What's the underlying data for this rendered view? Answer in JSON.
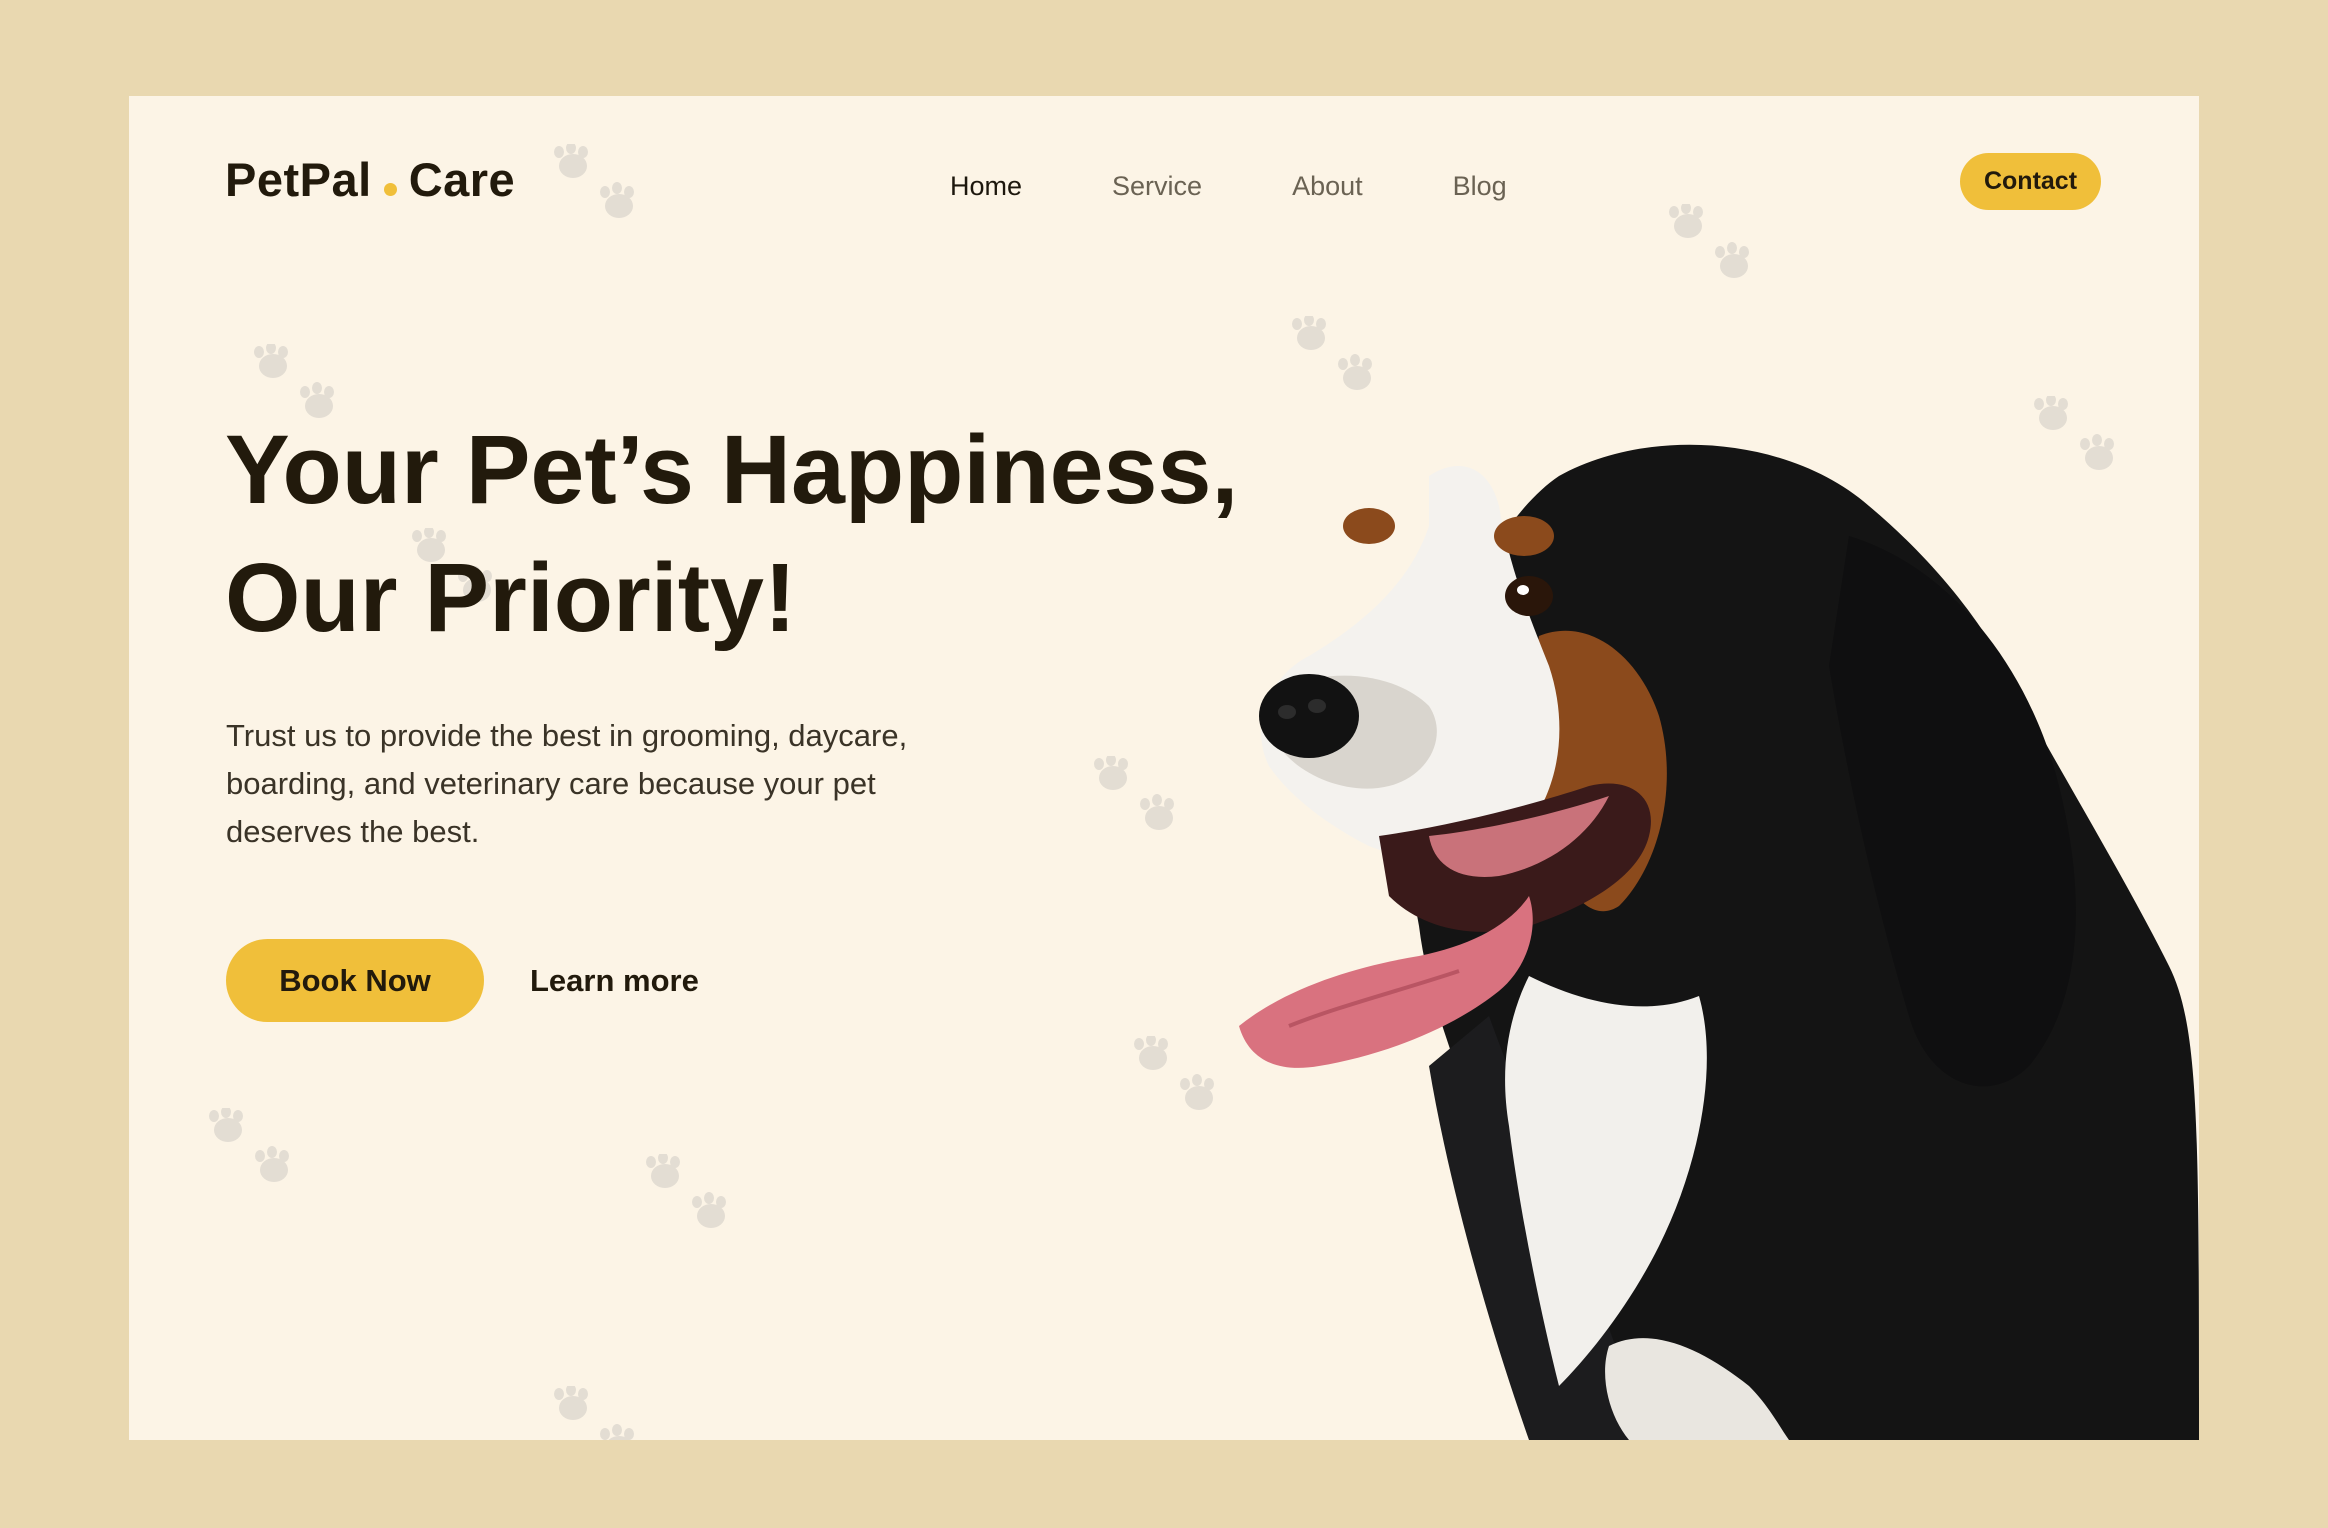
{
  "brand": {
    "name_left": "PetPal",
    "name_right": "Care",
    "accent": "#f0bf3a"
  },
  "nav": {
    "items": [
      {
        "label": "Home",
        "active": true
      },
      {
        "label": "Service",
        "active": false
      },
      {
        "label": "About",
        "active": false
      },
      {
        "label": "Blog",
        "active": false
      }
    ],
    "contact_label": "Contact"
  },
  "hero": {
    "title_line1": "Your Pet’s Happiness,",
    "title_line2": "Our Priority!",
    "description": "Trust us to provide the best in grooming, daycare, boarding, and veterinary care because your pet deserves the best.",
    "primary_cta": "Book Now",
    "secondary_cta": "Learn more"
  },
  "decor": {
    "background_pattern": "paw-print-icon",
    "hero_image": "bernese-mountain-dog"
  },
  "colors": {
    "outer_background": "#e9d8b0",
    "page_background": "#fcf4e6",
    "text_dark": "#221a0c",
    "nav_muted": "#6a6253"
  }
}
